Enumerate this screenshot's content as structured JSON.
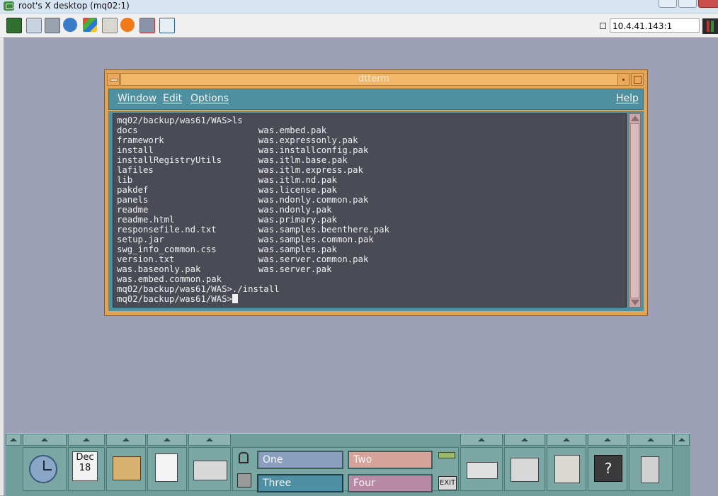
{
  "vnc": {
    "window_title": "root's X desktop (mq02:1)",
    "address": "10.4.41.143:1"
  },
  "dtterm": {
    "title": "dtterm",
    "menus": {
      "window": "Window",
      "edit": "Edit",
      "options": "Options",
      "help": "Help"
    },
    "lines": [
      "mq02/backup/was61/WAS>ls",
      "docs                       was.embed.pak",
      "framework                  was.expressonly.pak",
      "install                    was.installconfig.pak",
      "installRegistryUtils       was.itlm.base.pak",
      "lafiles                    was.itlm.express.pak",
      "lib                        was.itlm.nd.pak",
      "pakdef                     was.license.pak",
      "panels                     was.ndonly.common.pak",
      "readme                     was.ndonly.pak",
      "readme.html                was.primary.pak",
      "responsefile.nd.txt        was.samples.beenthere.pak",
      "setup.jar                  was.samples.common.pak",
      "swg_info_common.css        was.samples.pak",
      "version.txt                was.server.common.pak",
      "was.baseonly.pak           was.server.pak",
      "was.embed.common.pak",
      "mq02/backup/was61/WAS>./install"
    ],
    "prompt": "mq02/backup/was61/WAS>"
  },
  "panel": {
    "calendar_month": "Dec",
    "calendar_day": "18",
    "workspaces": {
      "one": "One",
      "two": "Two",
      "three": "Three",
      "four": "Four"
    },
    "exit_label": "EXIT",
    "colors": {
      "ws_one": "#8a9fbd",
      "ws_two": "#d6a39a",
      "ws_three": "#4e8fa3",
      "ws_four": "#b98aa6"
    }
  }
}
